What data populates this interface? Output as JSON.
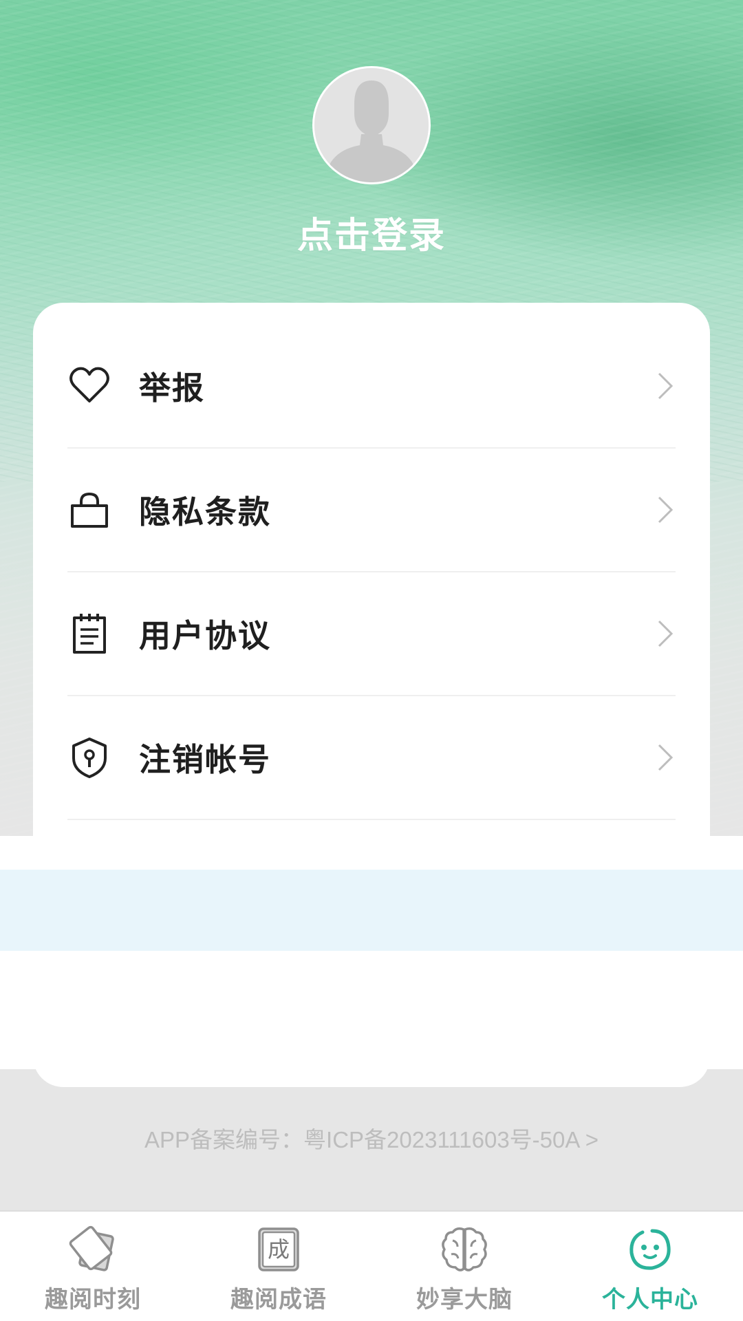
{
  "header": {
    "login_text": "点击登录"
  },
  "menu": {
    "items": [
      {
        "label": "举报",
        "icon": "heart-icon"
      },
      {
        "label": "隐私条款",
        "icon": "bag-icon"
      },
      {
        "label": "用户协议",
        "icon": "notepad-icon"
      },
      {
        "label": "注销帐号",
        "icon": "shield-keyhole-icon"
      }
    ]
  },
  "footer": {
    "icp_text": "APP备案编号：粤ICP备2023111603号-50A >"
  },
  "tabbar": {
    "tabs": [
      {
        "label": "趣阅时刻",
        "icon": "cards-icon",
        "active": false
      },
      {
        "label": "趣阅成语",
        "icon": "idiom-icon",
        "icon_glyph": "成",
        "active": false
      },
      {
        "label": "妙享大脑",
        "icon": "brain-icon",
        "active": false
      },
      {
        "label": "个人中心",
        "icon": "smiley-icon",
        "active": true
      }
    ]
  },
  "colors": {
    "accent": "#2bb39a",
    "inactive_tab": "#9a9a9a",
    "header_green": "#7fd2a8",
    "page_bg": "#e6e6e6",
    "band_blue": "#e8f5fb"
  }
}
